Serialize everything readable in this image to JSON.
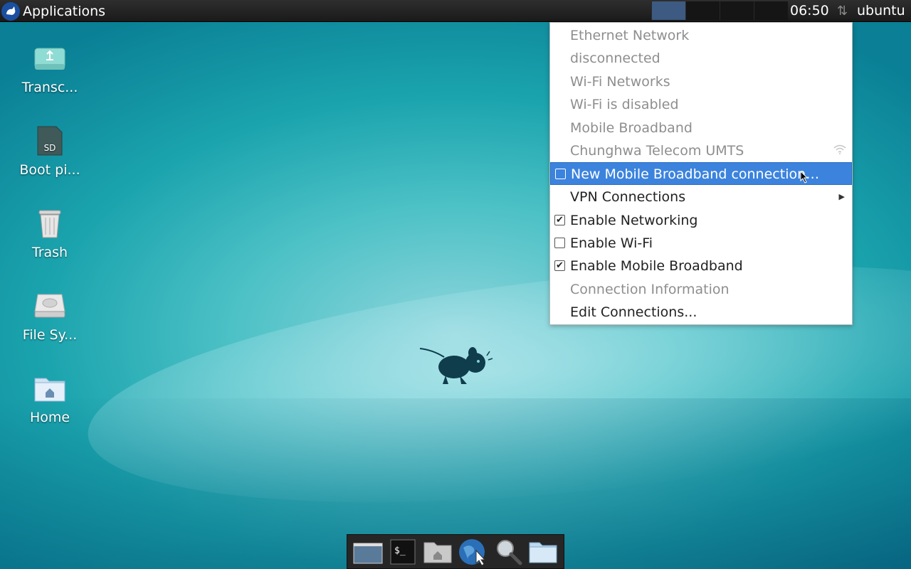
{
  "top_panel": {
    "applications_label": "Applications",
    "clock": "06:50",
    "user": "ubuntu"
  },
  "desktop_icons": [
    {
      "label": "Transc...",
      "icon": "usb-drive-icon"
    },
    {
      "label": "Boot pi...",
      "icon": "sd-card-icon"
    },
    {
      "label": "Trash",
      "icon": "trash-icon"
    },
    {
      "label": "File Sy...",
      "icon": "hard-disk-icon"
    },
    {
      "label": "Home",
      "icon": "home-folder-icon"
    }
  ],
  "network_menu": {
    "items": [
      {
        "label": "Ethernet Network"
      },
      {
        "label": "disconnected"
      },
      {
        "label": "Wi-Fi Networks"
      },
      {
        "label": "Wi-Fi is disabled"
      },
      {
        "label": "Mobile Broadband"
      },
      {
        "label": "Chunghwa Telecom UMTS"
      },
      {
        "label": "New Mobile Broadband connection…",
        "checked": false
      },
      {
        "label": "VPN Connections"
      },
      {
        "label": "Enable Networking",
        "checked": true
      },
      {
        "label": "Enable Wi-Fi",
        "checked": false
      },
      {
        "label": "Enable Mobile Broadband",
        "checked": true
      },
      {
        "label": "Connection Information"
      },
      {
        "label": "Edit Connections..."
      }
    ]
  },
  "dock": {
    "items": [
      "show-desktop-icon",
      "terminal-icon",
      "home-folder-icon",
      "web-browser-icon",
      "app-finder-icon",
      "files-folder-icon"
    ]
  },
  "colors": {
    "panel": "#1f1f1f",
    "highlight": "#3c83dd",
    "wallpaper": "#1aa3ad"
  }
}
